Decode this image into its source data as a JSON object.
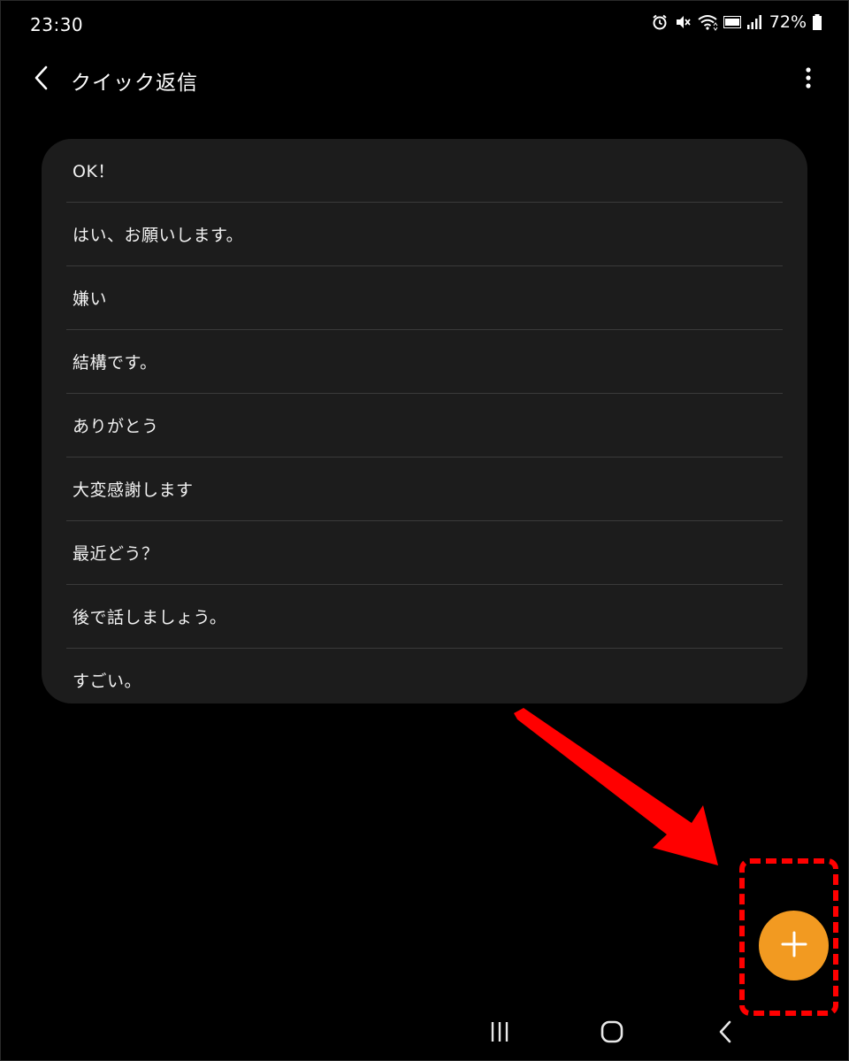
{
  "status_bar": {
    "time": "23:30",
    "battery_percent": "72%",
    "icons": [
      "alarm-icon",
      "vibrate-mute-icon",
      "wifi-icon",
      "volte-icon",
      "signal-icon",
      "battery-icon"
    ]
  },
  "app_bar": {
    "title": "クイック返信",
    "back_icon": "chevron-left-icon",
    "more_icon": "more-vertical-icon"
  },
  "quick_replies": [
    {
      "label": "OK！"
    },
    {
      "label": "はい、お願いします。"
    },
    {
      "label": "嫌い"
    },
    {
      "label": "結構です。"
    },
    {
      "label": "ありがとう"
    },
    {
      "label": "大変感謝します"
    },
    {
      "label": "最近どう？"
    },
    {
      "label": "後で話しましょう。"
    },
    {
      "label": "すごい。"
    }
  ],
  "fab": {
    "icon": "plus-icon",
    "color": "#f29a21"
  },
  "annotation": {
    "arrow_color": "#ff0000",
    "highlight_color": "#ff0000"
  },
  "nav_bar": {
    "recents_icon": "recents-icon",
    "home_icon": "home-icon",
    "back_icon": "back-icon"
  }
}
